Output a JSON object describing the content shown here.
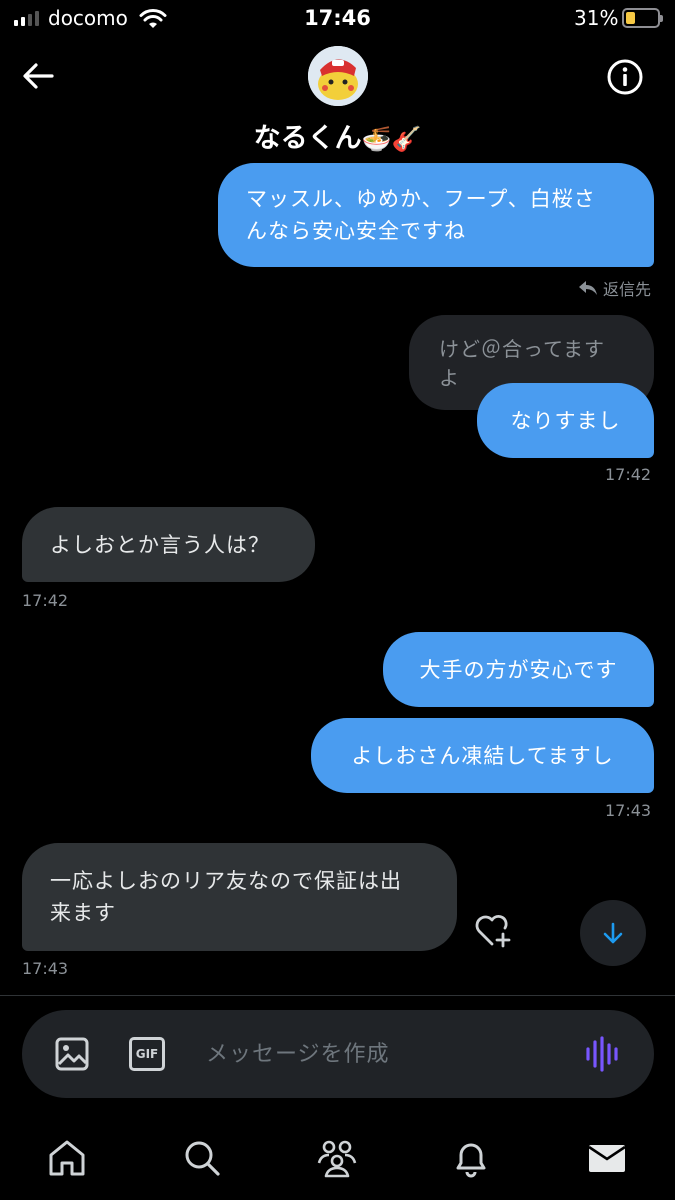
{
  "status": {
    "carrier": "docomo",
    "time": "17:46",
    "battery_percent": "31%",
    "battery_level": 0.31
  },
  "header": {
    "contact_name": "なるくん",
    "name_emoji": "🍜🎸",
    "back_icon": "back-arrow-icon",
    "info_icon": "info-icon"
  },
  "messages": [
    {
      "direction": "out",
      "text": "マッスル、ゆめか、フープ、白桜さ\nんなら安心安全ですね"
    },
    {
      "reply_label": "返信先"
    },
    {
      "quoted_text": "けど＠合ってますよ"
    },
    {
      "direction": "out",
      "text": "なりすまし",
      "time": "17:42"
    },
    {
      "direction": "in",
      "text": "よしおとか言う人は？",
      "time": "17:42"
    },
    {
      "direction": "out",
      "text": "大手の方が安心です"
    },
    {
      "direction": "out",
      "text": "よしおさん凍結してますし",
      "time": "17:43"
    },
    {
      "direction": "in",
      "text": "一応よしおのリア友なので保証は出\n来ます",
      "time": "17:43"
    }
  ],
  "composer": {
    "placeholder": "メッセージを作成",
    "gif_label": "GIF",
    "accent_color": "#7856ff"
  },
  "tabs": [
    {
      "icon": "home-icon"
    },
    {
      "icon": "search-icon"
    },
    {
      "icon": "communities-icon"
    },
    {
      "icon": "notifications-icon"
    },
    {
      "icon": "messages-icon",
      "active": true
    }
  ],
  "colors": {
    "outgoing_bubble": "#4a9cf0",
    "incoming_bubble": "#2f3336",
    "background": "#000000"
  }
}
